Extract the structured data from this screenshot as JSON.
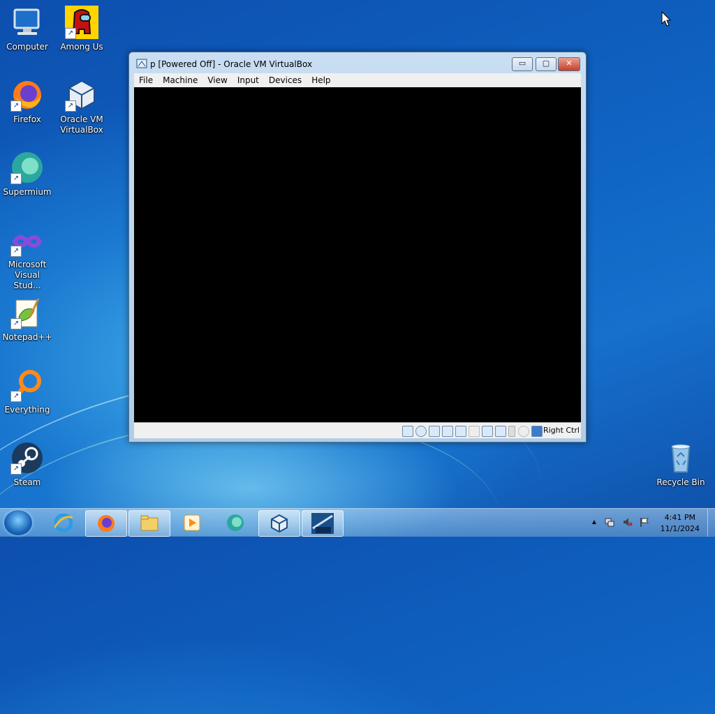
{
  "desktop": {
    "icons": [
      {
        "label": "Computer"
      },
      {
        "label": "Among Us"
      },
      {
        "label": "Firefox"
      },
      {
        "label": "Oracle VM VirtualBox"
      },
      {
        "label": "Supermium"
      },
      {
        "label": "Microsoft Visual Stud..."
      },
      {
        "label": "Notepad++"
      },
      {
        "label": "Everything"
      },
      {
        "label": "Steam"
      },
      {
        "label": "Recycle Bin"
      }
    ]
  },
  "window": {
    "title": "p [Powered Off] - Oracle VM VirtualBox",
    "minimize_glyph": "▭",
    "maximize_glyph": "▢",
    "close_glyph": "✕",
    "menu": [
      "File",
      "Machine",
      "View",
      "Input",
      "Devices",
      "Help"
    ],
    "host_key": "Right Ctrl"
  },
  "taskbar": {
    "clock_time": "4:41 PM",
    "clock_date": "11/1/2024",
    "tray_chevron": "▲",
    "pinned": [
      "start-orb",
      "internet-explorer-icon",
      "firefox-icon",
      "file-explorer-icon",
      "media-player-icon",
      "supermium-icon",
      "virtualbox-icon",
      "windows-2000-icon"
    ]
  },
  "colors": {
    "accent": "#1670cc",
    "vm_screen": "#000000"
  }
}
